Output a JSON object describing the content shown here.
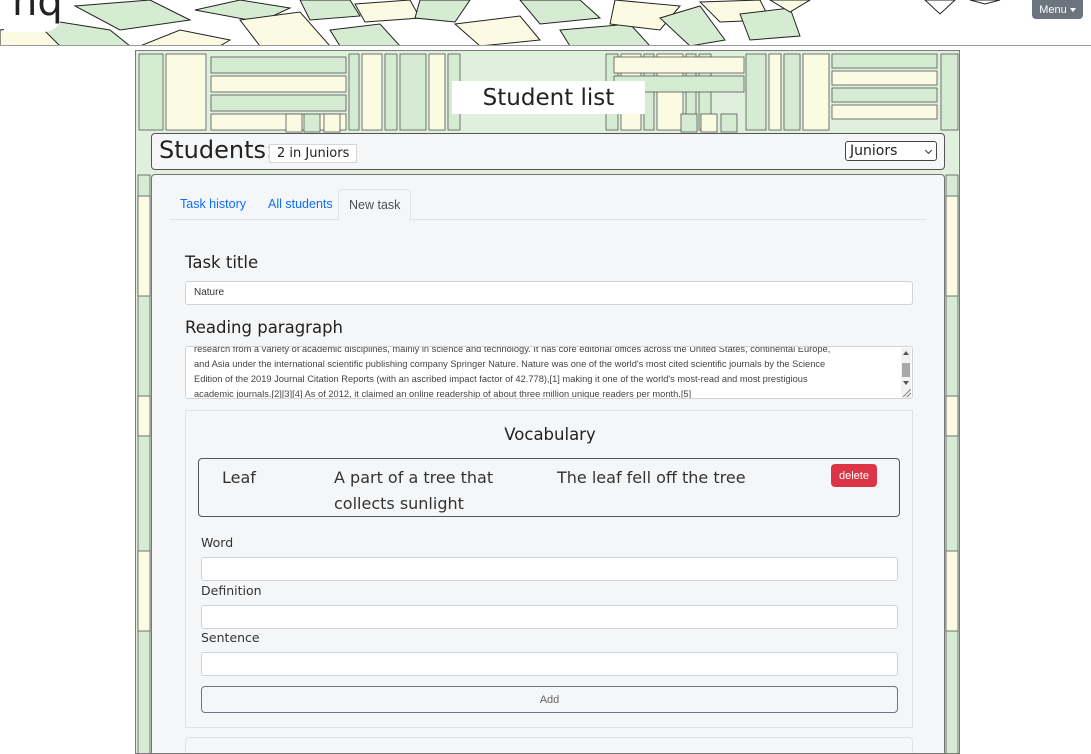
{
  "header": {
    "logo_text": "hq",
    "menu_label": "Menu"
  },
  "page": {
    "title": "Student list"
  },
  "students_bar": {
    "label": "Students:",
    "count_text": "2 in Juniors",
    "selected_group": "Juniors"
  },
  "tabs": [
    {
      "label": "Task history",
      "active": false
    },
    {
      "label": "All students",
      "active": false
    },
    {
      "label": "New task",
      "active": true
    }
  ],
  "task_form": {
    "title_label": "Task title",
    "title_value": "Nature",
    "paragraph_label": "Reading paragraph",
    "paragraph_lines": [
      "research from a variety of academic disciplines, mainly in science and technology. It has core editorial offices across the United States, continental Europe,",
      "and Asia under the international scientific publishing company Springer Nature. Nature was one of the world's most cited scientific journals by the Science",
      "Edition of the 2019 Journal Citation Reports (with an ascribed impact factor of 42.778),[1] making it one of the world's most-read and most prestigious",
      "academic journals.[2][3][4] As of 2012, it claimed an online readership of about three million unique readers per month.[5]"
    ]
  },
  "vocabulary": {
    "heading": "Vocabulary",
    "entries": [
      {
        "word": "Leaf",
        "definition": "A part of a tree that collects sunlight",
        "sentence": "The leaf fell off the tree",
        "delete_label": "delete"
      }
    ],
    "word_label": "Word",
    "word_value": "",
    "definition_label": "Definition",
    "definition_value": "",
    "sentence_label": "Sentence",
    "sentence_value": "",
    "add_label": "Add"
  },
  "colors": {
    "menu_button": "#6c757d",
    "link": "#0d6efd",
    "delete_button": "#dc3545",
    "shelf_green": "#d6ecd2",
    "shelf_cream": "#fbfbe3"
  }
}
